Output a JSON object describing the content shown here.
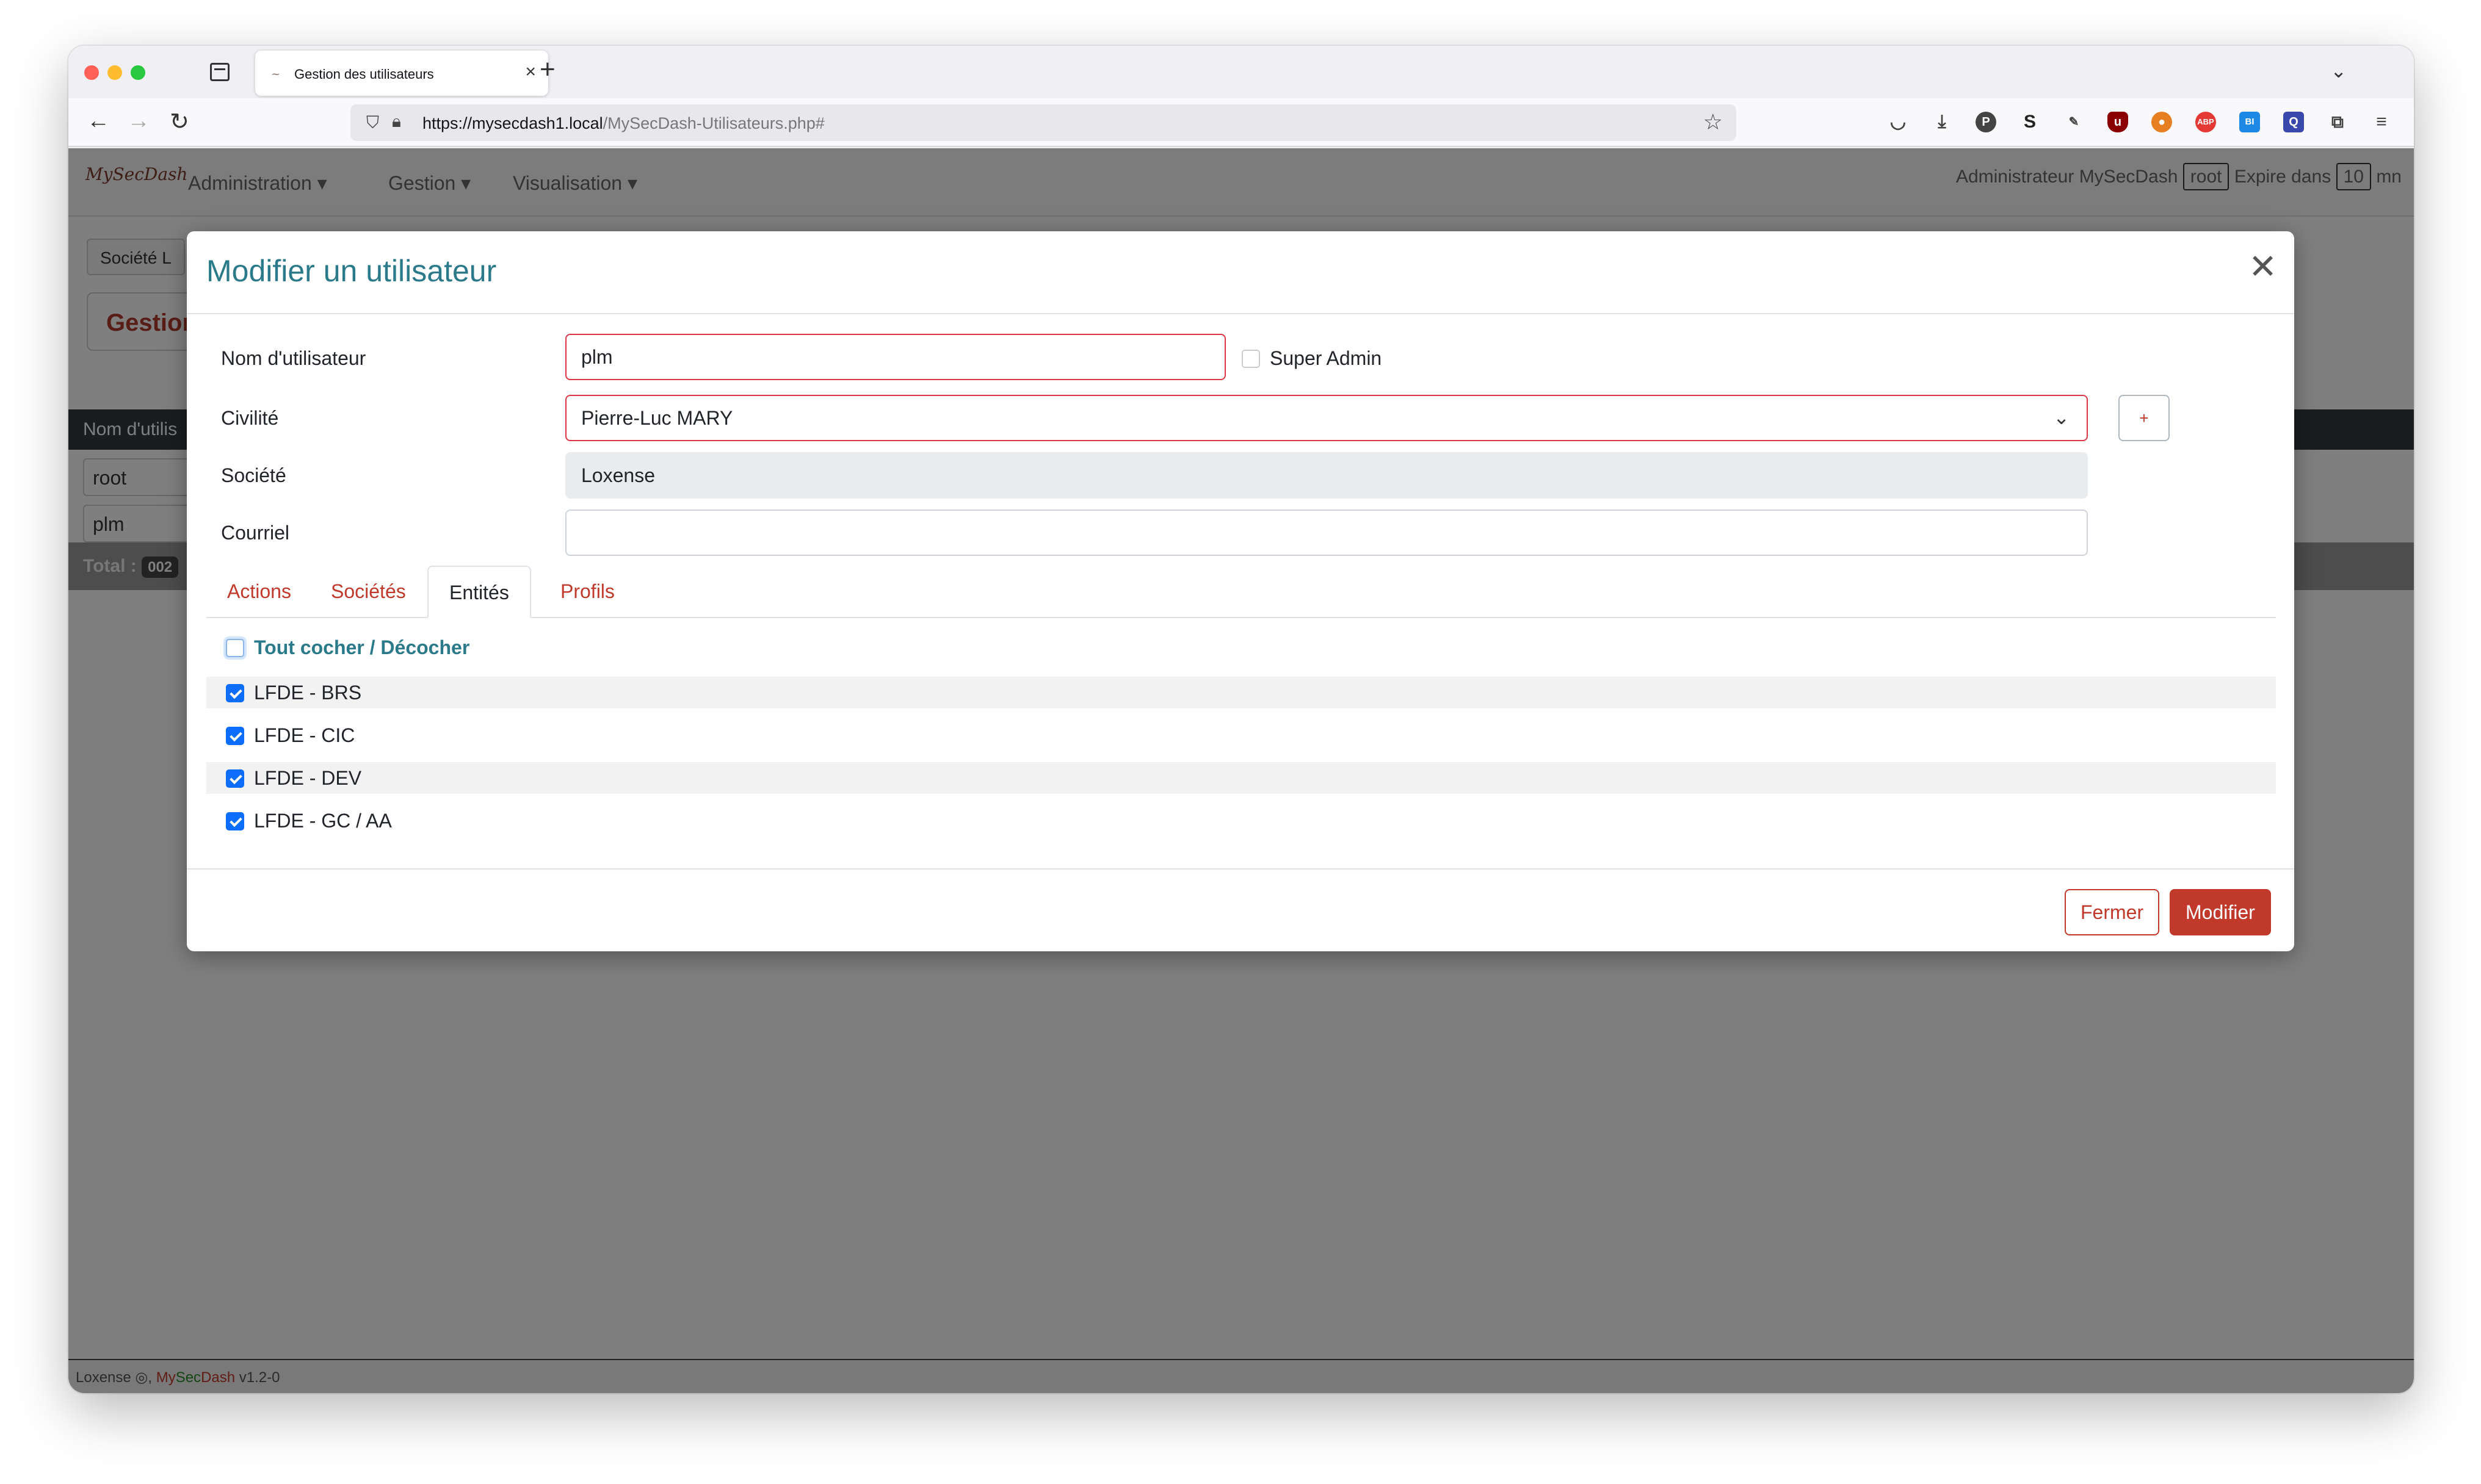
{
  "browser": {
    "tab_title": "Gestion des utilisateurs",
    "url_host": "https://mysecdash1.local",
    "url_path": "/MySecDash-Utilisateurs.php#"
  },
  "app": {
    "logo_text": "MySecDash",
    "menu": [
      "Administration ▾",
      "Gestion ▾",
      "Visualisation ▾"
    ],
    "user_info": "Administrateur MySecDash",
    "user_badge": "root",
    "expire_label": "Expire dans",
    "expire_value": "10",
    "expire_unit": "mn",
    "breadcrumb": "Société",
    "breadcrumb_suffix": "L",
    "page_heading": "Gestion",
    "table_header": "Nom d'utilis",
    "rows": [
      "root",
      "plm"
    ],
    "total_label": "Total :",
    "total_value": "002",
    "footer_company": "Loxense",
    "footer_brand_my": "My",
    "footer_brand_sec": "Sec",
    "footer_brand_dash": "Dash",
    "footer_version": "v1.2-0"
  },
  "modal": {
    "title": "Modifier un utilisateur",
    "fields": {
      "username_label": "Nom d'utilisateur",
      "username_value": "plm",
      "superadmin_label": "Super Admin",
      "civilite_label": "Civilité",
      "civilite_value": "Pierre-Luc MARY",
      "societe_label": "Société",
      "societe_value": "Loxense",
      "courriel_label": "Courriel",
      "courriel_value": "",
      "plus_label": "+"
    },
    "tabs": [
      {
        "label": "Actions",
        "active": false
      },
      {
        "label": "Sociétés",
        "active": false
      },
      {
        "label": "Entités",
        "active": true
      },
      {
        "label": "Profils",
        "active": false
      }
    ],
    "check_all_label": "Tout cocher / Décocher",
    "entities": [
      {
        "label": "LFDE - BRS",
        "checked": true
      },
      {
        "label": "LFDE - CIC",
        "checked": true
      },
      {
        "label": "LFDE - DEV",
        "checked": true
      },
      {
        "label": "LFDE - GC / AA",
        "checked": true
      }
    ],
    "buttons": {
      "close": "Fermer",
      "modify": "Modifier"
    }
  },
  "colors": {
    "accent_red": "#c0392b",
    "title_teal": "#2b7a8a",
    "checkbox_blue": "#0d6efd"
  }
}
